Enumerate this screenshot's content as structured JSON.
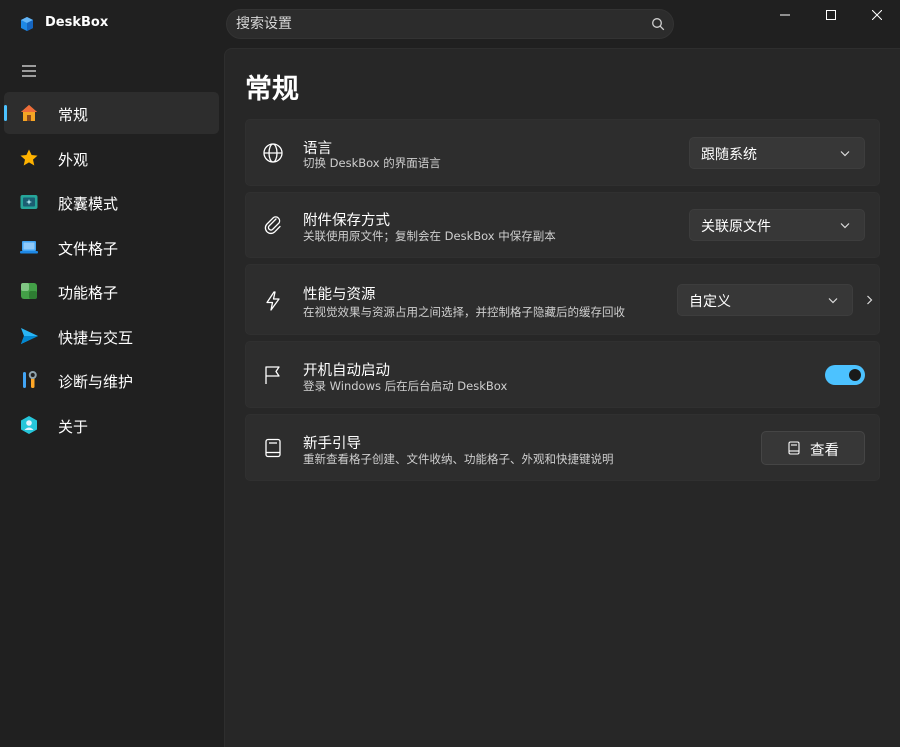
{
  "app": {
    "title": "DeskBox",
    "accent": "#4cc2ff"
  },
  "search": {
    "placeholder": "搜索设置"
  },
  "sidebar": {
    "items": [
      {
        "label": "常规",
        "icon": "home-icon",
        "active": true
      },
      {
        "label": "外观",
        "icon": "star-icon",
        "active": false
      },
      {
        "label": "胶囊模式",
        "icon": "capsule-icon",
        "active": false
      },
      {
        "label": "文件格子",
        "icon": "laptop-icon",
        "active": false
      },
      {
        "label": "功能格子",
        "icon": "grid-icon",
        "active": false
      },
      {
        "label": "快捷与交互",
        "icon": "send-icon",
        "active": false
      },
      {
        "label": "诊断与维护",
        "icon": "tools-icon",
        "active": false
      },
      {
        "label": "关于",
        "icon": "info-badge-icon",
        "active": false
      }
    ]
  },
  "page": {
    "title": "常规"
  },
  "settings": {
    "language": {
      "title": "语言",
      "desc": "切换 DeskBox 的界面语言",
      "value": "跟随系统",
      "icon": "globe-icon"
    },
    "attachment": {
      "title": "附件保存方式",
      "desc": "关联使用原文件；复制会在 DeskBox 中保存副本",
      "value": "关联原文件",
      "icon": "paperclip-icon"
    },
    "performance": {
      "title": "性能与资源",
      "desc": "在视觉效果与资源占用之间选择，并控制格子隐藏后的缓存回收",
      "value": "自定义",
      "icon": "lightning-icon"
    },
    "autostart": {
      "title": "开机自动启动",
      "desc": "登录 Windows 后在后台启动 DeskBox",
      "enabled": true,
      "icon": "flag-icon"
    },
    "guide": {
      "title": "新手引导",
      "desc": "重新查看格子创建、文件收纳、功能格子、外观和快捷键说明",
      "button": "查看",
      "icon": "book-icon"
    }
  }
}
